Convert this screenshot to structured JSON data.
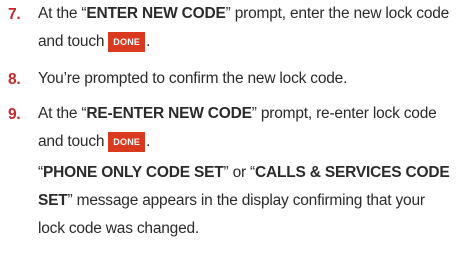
{
  "steps": [
    {
      "number": "7.",
      "line1_pre": "At the “",
      "line1_bold": "ENTER NEW CODE",
      "line1_post": "” prompt, enter the new lock code",
      "line2_pre": "and touch",
      "button": "DONE",
      "line2_post": "."
    },
    {
      "number": "8.",
      "text": "You’re prompted to confirm the new lock code."
    },
    {
      "number": "9.",
      "line1_pre": "At the “",
      "line1_bold": "RE-ENTER NEW CODE",
      "line1_post": "” prompt, re-enter lock code",
      "line2_pre": "and touch",
      "button": "DONE",
      "line2_post": "."
    }
  ],
  "note": {
    "q1": "“",
    "bold1": "PHONE ONLY CODE SET",
    "mid": "” or “",
    "bold2a": "CALLS & SERVICES CODE",
    "bold2b": "SET",
    "line2_post": "” message appears in the display confirming that your",
    "line3": "lock code was changed."
  },
  "colors": {
    "step_number": "#c2282a",
    "done_button_bg": "#d93a1f",
    "body_text": "#2b2b2b"
  }
}
